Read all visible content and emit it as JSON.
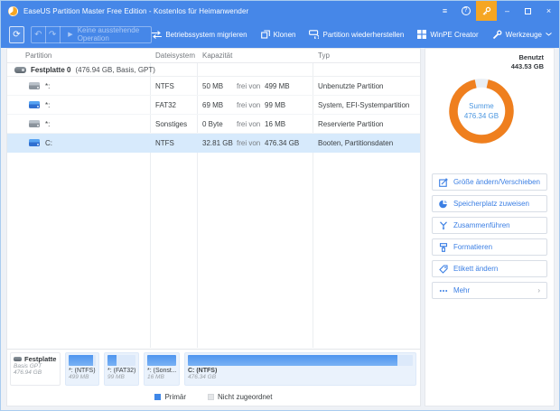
{
  "titlebar": {
    "title": "EaseUS Partition Master Free Edition - Kostenlos für Heimanwender",
    "minimize_glyph": "–",
    "close_glyph": "×",
    "help_glyph": "?",
    "menu_glyph": "≡",
    "upgrade_color": "#F5A623"
  },
  "toolbar": {
    "pending_operation": "Keine ausstehende Operation",
    "undo_glyph": "↶",
    "redo_glyph": "↷",
    "play_glyph": "▶",
    "refresh_glyph": "⟳",
    "actions": [
      {
        "label": "Betriebssystem migrieren",
        "icon": "migrate-icon"
      },
      {
        "label": "Klonen",
        "icon": "clone-icon"
      },
      {
        "label": "Partition wiederherstellen",
        "icon": "partition-recover-icon"
      },
      {
        "label": "WinPE Creator",
        "icon": "winpe-icon"
      },
      {
        "label": "Werkzeuge",
        "icon": "tools-icon"
      }
    ]
  },
  "table": {
    "columns": [
      "Partition",
      "Dateisystem",
      "Kapazität",
      "Typ"
    ],
    "disk_group": {
      "name": "Festplatte 0",
      "details": "(476.94 GB, Basis, GPT)"
    },
    "free_word": "frei von",
    "rows": [
      {
        "label": "*:",
        "fs": "NTFS",
        "free": "50 MB",
        "total": "499 MB",
        "type": "Unbenutzte Partition"
      },
      {
        "label": "*:",
        "fs": "FAT32",
        "free": "69 MB",
        "total": "99 MB",
        "type": "System, EFI-Systempartition"
      },
      {
        "label": "*:",
        "fs": "Sonstiges",
        "free": "0 Byte",
        "total": "16 MB",
        "type": "Reservierte Partition"
      },
      {
        "label": "C:",
        "fs": "NTFS",
        "free": "32.81 GB",
        "total": "476.34 GB",
        "type": "Booten, Partitionsdaten"
      }
    ],
    "selected_row_index": 3
  },
  "usage_chart": {
    "type": "donut",
    "center_label": "Summe",
    "center_value": "476.34 GB",
    "used_label": "Benutzt",
    "used_value": "443.53 GB",
    "used_percent": 93.1,
    "ring_color": "#EF7F1E",
    "track_color": "#E9EEF4"
  },
  "side_actions": [
    {
      "label": "Größe ändern/Verschieben",
      "icon": "resize-move-icon"
    },
    {
      "label": "Speicherplatz zuweisen",
      "icon": "allocate-space-icon"
    },
    {
      "label": "Zusammenführen",
      "icon": "merge-icon"
    },
    {
      "label": "Formatieren",
      "icon": "format-icon"
    },
    {
      "label": "Etikett ändern",
      "icon": "label-icon"
    },
    {
      "label": "Mehr",
      "icon": "more-dots-icon",
      "chevron": "›"
    }
  ],
  "disk_map": {
    "disk": {
      "name": "Festplatte 0",
      "layout": "Basis GPT",
      "size": "476.94 GB"
    },
    "blocks": [
      {
        "name": "*: (NTFS)",
        "size": "499 MB",
        "fill_percent": 90
      },
      {
        "name": "*: (FAT32)",
        "size": "99 MB",
        "fill_percent": 31
      },
      {
        "name": "*: (Sonst...",
        "size": "16 MB",
        "fill_percent": 100
      },
      {
        "name": "C: (NTFS)",
        "size": "476.34 GB",
        "fill_percent": 93
      }
    ],
    "legend": [
      {
        "label": "Primär",
        "color": "#3F87E8"
      },
      {
        "label": "Nicht zugeordnet",
        "color": "#E4E6E8"
      }
    ]
  }
}
